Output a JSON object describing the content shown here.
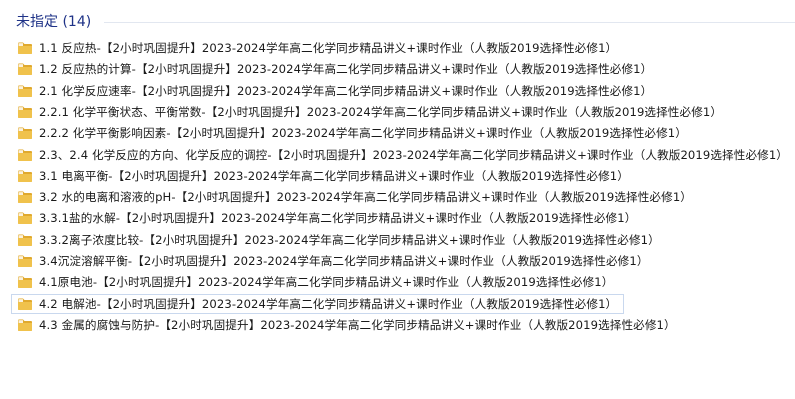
{
  "group": {
    "title": "未指定 (14)"
  },
  "items": [
    {
      "label": "1.1 反应热-【2小时巩固提升】2023-2024学年高二化学同步精品讲义+课时作业（人教版2019选择性必修1）",
      "selected": false
    },
    {
      "label": "1.2 反应热的计算-【2小时巩固提升】2023-2024学年高二化学同步精品讲义+课时作业（人教版2019选择性必修1）",
      "selected": false
    },
    {
      "label": "2.1 化学反应速率-【2小时巩固提升】2023-2024学年高二化学同步精品讲义+课时作业（人教版2019选择性必修1）",
      "selected": false
    },
    {
      "label": "2.2.1 化学平衡状态、平衡常数-【2小时巩固提升】2023-2024学年高二化学同步精品讲义+课时作业（人教版2019选择性必修1）",
      "selected": false
    },
    {
      "label": "2.2.2 化学平衡影响因素-【2小时巩固提升】2023-2024学年高二化学同步精品讲义+课时作业（人教版2019选择性必修1）",
      "selected": false
    },
    {
      "label": "2.3、2.4 化学反应的方向、化学反应的调控-【2小时巩固提升】2023-2024学年高二化学同步精品讲义+课时作业（人教版2019选择性必修1）",
      "selected": false
    },
    {
      "label": "3.1 电离平衡-【2小时巩固提升】2023-2024学年高二化学同步精品讲义+课时作业（人教版2019选择性必修1）",
      "selected": false
    },
    {
      "label": "3.2 水的电离和溶液的pH-【2小时巩固提升】2023-2024学年高二化学同步精品讲义+课时作业（人教版2019选择性必修1）",
      "selected": false
    },
    {
      "label": "3.3.1盐的水解-【2小时巩固提升】2023-2024学年高二化学同步精品讲义+课时作业（人教版2019选择性必修1）",
      "selected": false
    },
    {
      "label": "3.3.2离子浓度比较-【2小时巩固提升】2023-2024学年高二化学同步精品讲义+课时作业（人教版2019选择性必修1）",
      "selected": false
    },
    {
      "label": "3.4沉淀溶解平衡-【2小时巩固提升】2023-2024学年高二化学同步精品讲义+课时作业（人教版2019选择性必修1）",
      "selected": false
    },
    {
      "label": "4.1原电池-【2小时巩固提升】2023-2024学年高二化学同步精品讲义+课时作业（人教版2019选择性必修1）",
      "selected": false
    },
    {
      "label": "4.2 电解池-【2小时巩固提升】2023-2024学年高二化学同步精品讲义+课时作业（人教版2019选择性必修1）",
      "selected": true
    },
    {
      "label": "4.3 金属的腐蚀与防护-【2小时巩固提升】2023-2024学年高二化学同步精品讲义+课时作业（人教版2019选择性必修1）",
      "selected": false
    }
  ],
  "icons": {
    "item_icon": "folder-icon"
  },
  "colors": {
    "header_text": "#1e3287",
    "selection_border": "#c9d8ee",
    "folder_fill": "#f0c24c"
  }
}
